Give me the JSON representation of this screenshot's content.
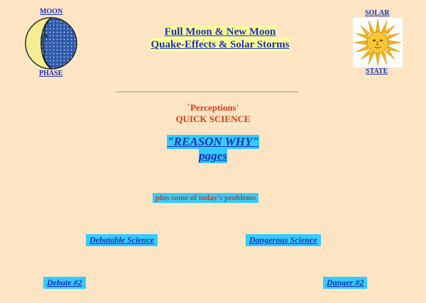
{
  "moon": {
    "top_label": "MOON",
    "bottom_label": "PHASE",
    "icon": "crescent-moon-face-icon"
  },
  "solar": {
    "top_label": "SOLAR",
    "bottom_label": "STATE",
    "icon": "sun-face-icon"
  },
  "title": {
    "line1": "Full Moon & New Moon",
    "line2": "Quake-Effects & Solar Storms"
  },
  "subtitle": {
    "line1": "`Perceptions'",
    "line2": "QUICK SCIENCE"
  },
  "reason": {
    "line1": "\"REASON  WHY\"",
    "line2": "pages"
  },
  "note": "plus some of today's problems",
  "links": {
    "debatable": "Debatable Science",
    "dangerous": "Dangerous Science",
    "debate2": "Debate #2",
    "danger2": "Danger #2"
  },
  "colors": {
    "background": "#fde5c3",
    "link": "#1a2fb8",
    "highlight_cyan": "#33ccff",
    "highlight_yellow": "#ffff99",
    "heading_red": "#d93c18"
  }
}
